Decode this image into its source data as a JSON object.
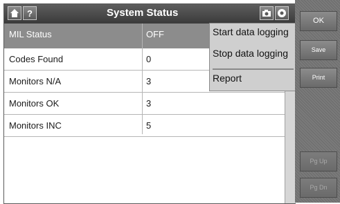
{
  "header": {
    "home_icon": "home-icon",
    "help_label": "?",
    "title": "System Status",
    "camera_icon": "camera-icon",
    "settings_icon": "gear-icon"
  },
  "table": {
    "rows": [
      {
        "label": "MIL Status",
        "value": "OFF"
      },
      {
        "label": "Codes Found",
        "value": "0"
      },
      {
        "label": "Monitors N/A",
        "value": "3"
      },
      {
        "label": "Monitors OK",
        "value": "3"
      },
      {
        "label": "Monitors INC",
        "value": "5"
      }
    ]
  },
  "menu": {
    "items": [
      "Start data logging",
      "Stop data logging",
      "Report"
    ]
  },
  "sidebar": {
    "ok": "OK",
    "save": "Save",
    "print": "Print",
    "pg_up": "Pg Up",
    "pg_dn": "Pg Dn"
  }
}
